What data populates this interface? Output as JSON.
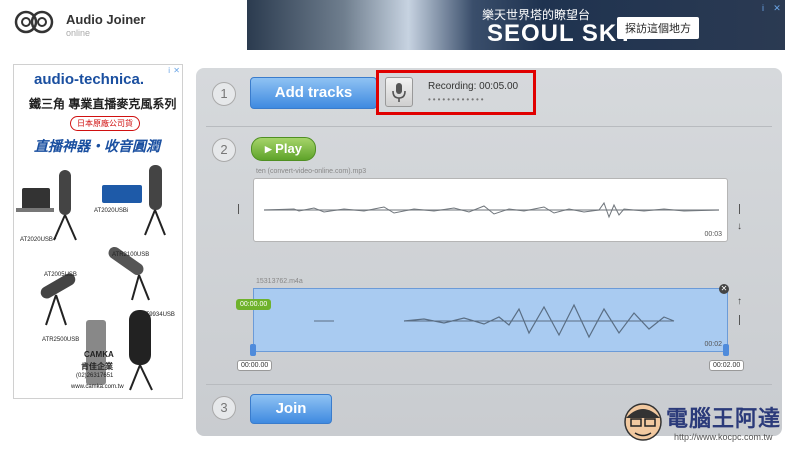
{
  "app": {
    "title": "Audio Joiner",
    "status": "online",
    "logo_icon": "headphones-logo-icon"
  },
  "top_ad": {
    "headline": "樂天世界塔的瞭望台",
    "title": "SEOUL SKY",
    "button": "探訪這個地方",
    "close": "✕",
    "info": "i"
  },
  "side_ad": {
    "brand": "audio-technica.",
    "line1": "鐵三角 專業直播麥克風系列",
    "badge": "日本原廠公司貨",
    "line2": "直播神器・收音圓潤",
    "labels": [
      "AT2020USBi",
      "AT2020USB+",
      "ATR2100USB",
      "AT2005USB",
      "AT9934USB",
      "ATR2500USB"
    ],
    "camka": "CAMKA",
    "company": "肯佳企業",
    "phone": "(02)26317651",
    "url": "www.camka.com.tw",
    "close": "✕",
    "info": "i"
  },
  "steps": [
    {
      "number": "1"
    },
    {
      "number": "2"
    },
    {
      "number": "3"
    }
  ],
  "toolbar": {
    "add_tracks": "Add tracks",
    "recording_label": "Recording: 00:05.00",
    "recording_dots": "••••••••••••",
    "play": "▸ Play",
    "join": "Join"
  },
  "tracks": [
    {
      "file": "ten (convert-video-online.com).mp3",
      "end_time": "00:03",
      "state": "normal"
    },
    {
      "file": "15313762.m4a",
      "start_badge": "00:00.00",
      "end_time": "00:02",
      "start_box": "00:00.00",
      "end_box": "00:02.00",
      "state": "selected"
    }
  ],
  "watermark": {
    "text": "電腦王阿達",
    "url": "http://www.kocpc.com.tw"
  },
  "colors": {
    "accent_blue": "#3f8ae0",
    "play_green": "#5ea32a",
    "highlight_red": "#e00000",
    "panel": "#d6d9dc",
    "selected_track": "#a9cbf1"
  }
}
